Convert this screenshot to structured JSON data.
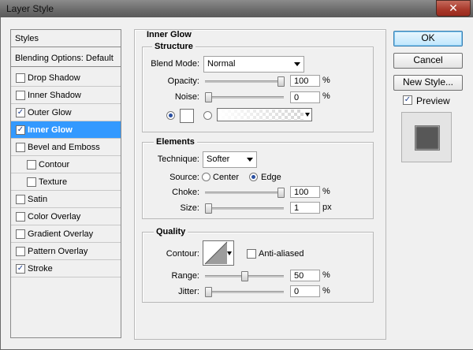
{
  "window": {
    "title": "Layer Style",
    "close_glyph": "✕"
  },
  "styles_list": {
    "title": "Styles",
    "blending": "Blending Options: Default",
    "items": [
      {
        "label": "Drop Shadow",
        "checked": false
      },
      {
        "label": "Inner Shadow",
        "checked": false
      },
      {
        "label": "Outer Glow",
        "checked": true
      },
      {
        "label": "Inner Glow",
        "checked": true,
        "selected": true
      },
      {
        "label": "Bevel and Emboss",
        "checked": false
      },
      {
        "label": "Contour",
        "checked": false,
        "indent": true
      },
      {
        "label": "Texture",
        "checked": false,
        "indent": true
      },
      {
        "label": "Satin",
        "checked": false
      },
      {
        "label": "Color Overlay",
        "checked": false
      },
      {
        "label": "Gradient Overlay",
        "checked": false
      },
      {
        "label": "Pattern Overlay",
        "checked": false
      },
      {
        "label": "Stroke",
        "checked": true
      }
    ]
  },
  "panel": {
    "title": "Inner Glow"
  },
  "structure": {
    "title": "Structure",
    "blend_mode_label": "Blend Mode:",
    "blend_mode_value": "Normal",
    "opacity_label": "Opacity:",
    "opacity_value": "100",
    "opacity_fraction": 1.0,
    "noise_label": "Noise:",
    "noise_value": "0",
    "noise_fraction": 0.0,
    "percent": "%",
    "color_swatch": "#ffffff"
  },
  "elements": {
    "title": "Elements",
    "technique_label": "Technique:",
    "technique_value": "Softer",
    "source_label": "Source:",
    "source_center": "Center",
    "source_edge": "Edge",
    "choke_label": "Choke:",
    "choke_value": "100",
    "choke_fraction": 1.0,
    "size_label": "Size:",
    "size_value": "1",
    "size_fraction": 0.0,
    "percent": "%",
    "px": "px"
  },
  "quality": {
    "title": "Quality",
    "contour_label": "Contour:",
    "anti_aliased_label": "Anti-aliased",
    "range_label": "Range:",
    "range_value": "50",
    "range_fraction": 0.5,
    "jitter_label": "Jitter:",
    "jitter_value": "0",
    "jitter_fraction": 0.0,
    "percent": "%"
  },
  "buttons": {
    "ok": "OK",
    "cancel": "Cancel",
    "new_style": "New Style..."
  },
  "preview": {
    "label": "Preview",
    "checked": true
  },
  "colors": {
    "selection": "#3399ff",
    "preview_square": "#575757"
  }
}
